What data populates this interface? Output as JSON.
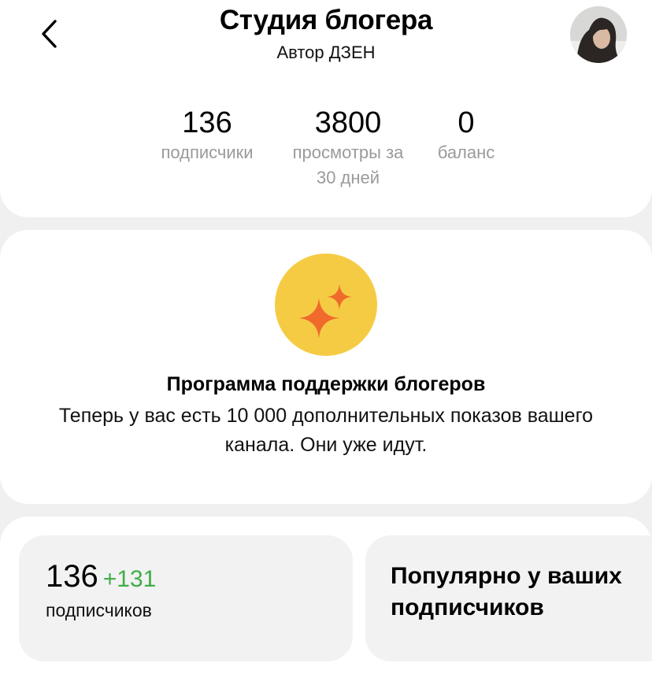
{
  "header": {
    "title": "Студия блогера",
    "subtitle": "Автор ДЗЕН",
    "back_icon": "chevron-left-icon",
    "avatar": "user-avatar"
  },
  "stats": [
    {
      "value": "136",
      "label": "подписчики"
    },
    {
      "value": "3800",
      "label": "просмотры за 30 дней"
    },
    {
      "value": "0",
      "label": "баланс"
    }
  ],
  "promo": {
    "icon": "sparkles-icon",
    "title": "Программа поддержки блогеров",
    "text": "Теперь у вас есть 10 000 дополнительных показов вашего канала. Они уже идут.",
    "colors": {
      "circle": "#f6cb44",
      "sparkle": "#f06a2c"
    }
  },
  "tiles": {
    "subscribers": {
      "value": "136",
      "delta": "+131",
      "label": "подписчиков"
    },
    "popular": {
      "heading": "Популярно у ваших подписчиков"
    }
  },
  "colors": {
    "background": "#f0f0f1",
    "card": "#ffffff",
    "muted": "#9a9a9a",
    "positive": "#3fae49"
  }
}
